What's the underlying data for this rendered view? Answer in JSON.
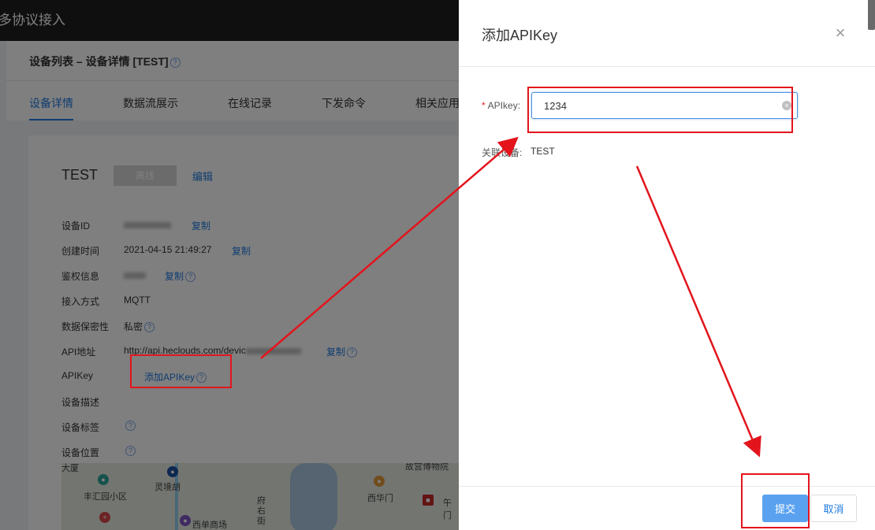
{
  "app": {
    "title": "多协议接入"
  },
  "breadcrumb": {
    "text": "设备列表 – 设备详情 [TEST]",
    "help": "?"
  },
  "tabs": [
    {
      "label": "设备详情",
      "active": true
    },
    {
      "label": "数据流展示"
    },
    {
      "label": "在线记录"
    },
    {
      "label": "下发命令"
    },
    {
      "label": "相关应用"
    }
  ],
  "device": {
    "name": "TEST",
    "status": "离线",
    "edit": "编辑",
    "copy": "复制",
    "help": "?",
    "rows": {
      "id_label": "设备ID",
      "created_label": "创建时间",
      "created_value": "2021-04-15 21:49:27",
      "auth_label": "鉴权信息",
      "access_label": "接入方式",
      "access_value": "MQTT",
      "privacy_label": "数据保密性",
      "privacy_value": "私密",
      "api_label": "API地址",
      "api_value": "http://api.heclouds.com/devic",
      "apikey_label": "APIKey",
      "apikey_link": "添加APIKey",
      "desc_label": "设备描述",
      "tags_label": "设备标签",
      "location_label": "设备位置"
    }
  },
  "map": {
    "labels": [
      "大厦",
      "灵境胡",
      "丰汇园小区",
      "府右街",
      "西单商场",
      "西华门",
      "故宫博物院",
      "午门"
    ]
  },
  "drawer": {
    "title": "添加APIKey",
    "close": "×",
    "field_label": "APIkey:",
    "required_mark": "*",
    "field_value": "1234",
    "clear": "×",
    "related_label": "关联设备:",
    "related_value": "TEST",
    "submit": "提交",
    "cancel": "取消"
  },
  "colors": {
    "primary": "#1f7ae0",
    "annotation": "#e3141c",
    "submit_bg": "#5aa2f0"
  }
}
